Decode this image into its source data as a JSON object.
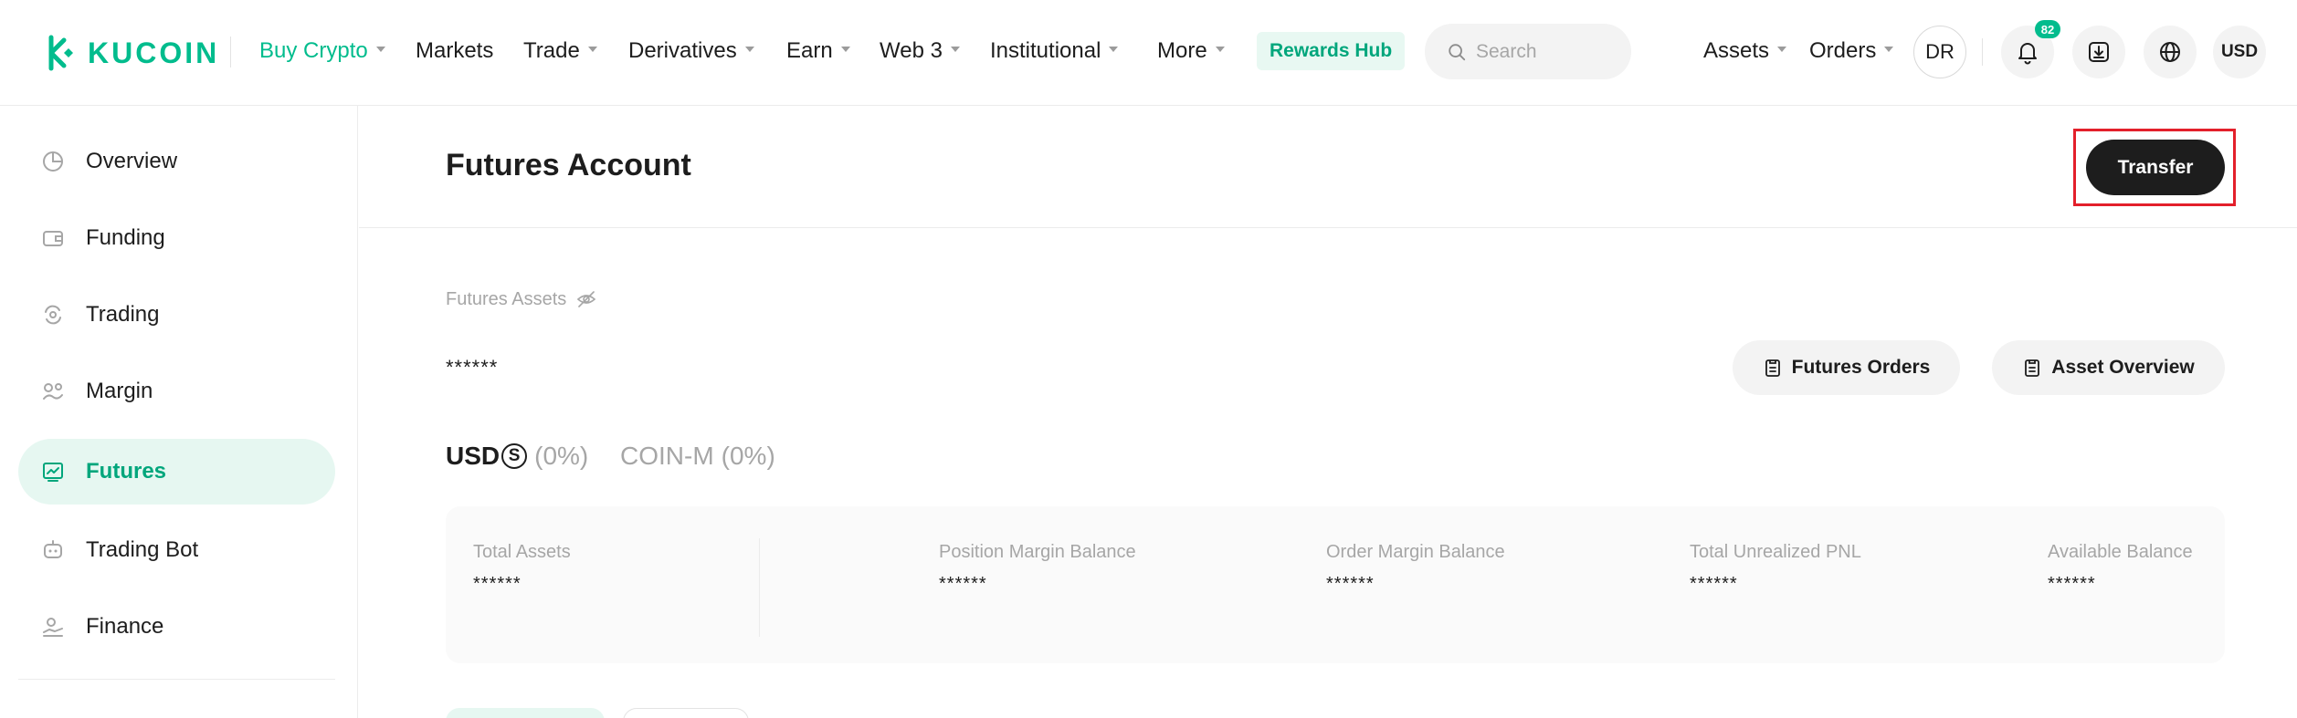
{
  "header": {
    "logo_text": "KUCOIN",
    "nav": [
      {
        "label": "Buy Crypto",
        "has_caret": true,
        "active": true
      },
      {
        "label": "Markets",
        "has_caret": false
      },
      {
        "label": "Trade",
        "has_caret": true
      },
      {
        "label": "Derivatives",
        "has_caret": true
      },
      {
        "label": "Earn",
        "has_caret": true
      },
      {
        "label": "Web 3",
        "has_caret": true
      },
      {
        "label": "Institutional",
        "has_caret": true
      },
      {
        "label": "More",
        "has_caret": true
      }
    ],
    "rewards_hub": "Rewards Hub",
    "search_placeholder": "Search",
    "assets": "Assets",
    "orders": "Orders",
    "avatar_initials": "DR",
    "notification_count": "82",
    "currency": "USD"
  },
  "sidebar": {
    "items": [
      {
        "label": "Overview",
        "icon": "pie-chart-icon"
      },
      {
        "label": "Funding",
        "icon": "wallet-icon"
      },
      {
        "label": "Trading",
        "icon": "exchange-icon"
      },
      {
        "label": "Margin",
        "icon": "margin-icon"
      },
      {
        "label": "Futures",
        "icon": "futures-chart-icon",
        "active": true
      },
      {
        "label": "Trading Bot",
        "icon": "robot-icon"
      },
      {
        "label": "Finance",
        "icon": "finance-icon"
      }
    ]
  },
  "main": {
    "title": "Futures Account",
    "transfer_button": "Transfer",
    "assets_label": "Futures Assets",
    "assets_value": "******",
    "futures_orders_button": "Futures Orders",
    "asset_overview_button": "Asset Overview",
    "tabs": [
      {
        "label": "USD",
        "suffix_glyph": "S",
        "pct": "(0%)",
        "active": true
      },
      {
        "label": "COIN-M",
        "pct": "(0%)",
        "active": false
      }
    ],
    "stats": [
      {
        "label": "Total Assets",
        "value": "******"
      },
      {
        "label": "Position Margin Balance",
        "value": "******"
      },
      {
        "label": "Order Margin Balance",
        "value": "******"
      },
      {
        "label": "Total Unrealized PNL",
        "value": "******"
      },
      {
        "label": "Available Balance",
        "value": "******"
      }
    ]
  },
  "colors": {
    "brand": "#01bc8d",
    "highlight": "#e3202b",
    "dark_button": "#1d1d1d"
  }
}
